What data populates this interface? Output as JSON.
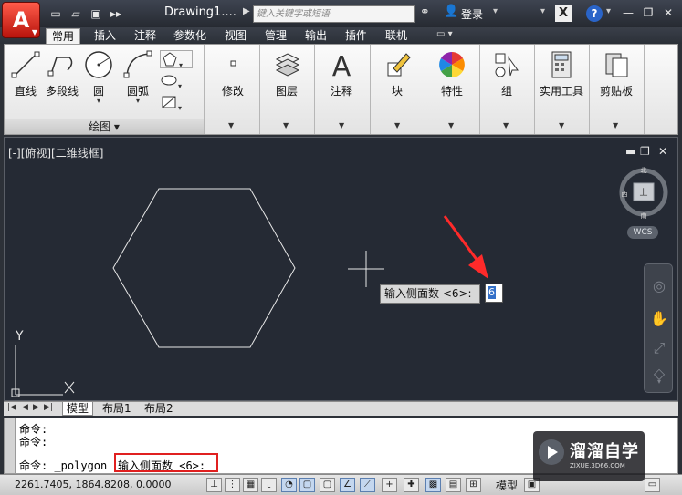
{
  "title_bar": {
    "doc_title": "Drawing1....",
    "search_placeholder": "键入关键字或短语",
    "login_label": "登录",
    "quick_access_icons": [
      "new-file-icon",
      "open-folder-icon",
      "save-icon",
      "more-icon"
    ]
  },
  "tabs": [
    "常用",
    "插入",
    "注释",
    "参数化",
    "视图",
    "管理",
    "输出",
    "插件",
    "联机"
  ],
  "ribbon": {
    "draw_tools": [
      {
        "label": "直线",
        "icon": "line-icon"
      },
      {
        "label": "多段线",
        "icon": "polyline-icon"
      },
      {
        "label": "圆",
        "icon": "circle-icon"
      },
      {
        "label": "圆弧",
        "icon": "arc-icon"
      }
    ],
    "draw_panel_title": "绘图 ▾",
    "panels": [
      {
        "label": "修改",
        "icon": "modify-icon"
      },
      {
        "label": "图层",
        "icon": "layer-icon"
      },
      {
        "label": "注释",
        "icon": "annotation-A-icon"
      },
      {
        "label": "块",
        "icon": "block-icon"
      },
      {
        "label": "特性",
        "icon": "color-wheel-icon"
      },
      {
        "label": "组",
        "icon": "group-icon"
      },
      {
        "label": "实用工具",
        "icon": "calculator-icon"
      },
      {
        "label": "剪贴板",
        "icon": "clipboard-icon"
      }
    ]
  },
  "viewport": {
    "label": "[-][俯视][二维线框]",
    "compass": {
      "north": "北",
      "south": "南",
      "west": "西",
      "top": "上"
    },
    "wcs_label": "WCS",
    "axis_y": "Y",
    "polygon_prompt": "输入侧面数 <6>:",
    "polygon_input": "6"
  },
  "layout_tabs": [
    "模型",
    "布局1",
    "布局2"
  ],
  "command": {
    "line1": "命令:",
    "line2": "命令:",
    "current_prefix": "命令: _polygon",
    "current_prompt": "输入侧面数 <6>:"
  },
  "status": {
    "coordinates": "2261.7405, 1864.8208, 0.0000",
    "model_label": "模型"
  },
  "watermark": {
    "name": "溜溜自学",
    "url": "ZIXUE.3D66.COM"
  }
}
